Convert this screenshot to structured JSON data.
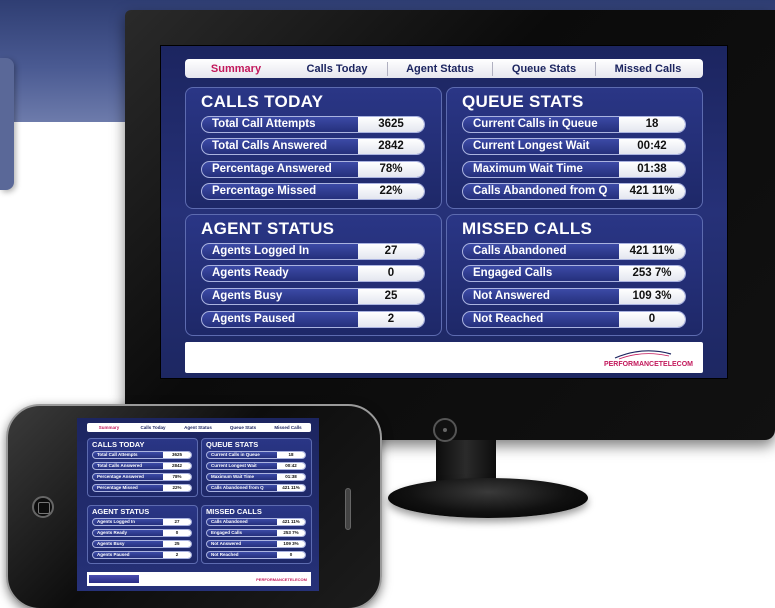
{
  "tabs": [
    "Summary",
    "Calls Today",
    "Agent Status",
    "Queue Stats",
    "Missed Calls"
  ],
  "active_tab": "Summary",
  "panels": {
    "calls_today": {
      "title": "CALLS TODAY",
      "rows": [
        {
          "label": "Total Call Attempts",
          "value": "3625"
        },
        {
          "label": "Total Calls Answered",
          "value": "2842"
        },
        {
          "label": "Percentage Answered",
          "value": "78%"
        },
        {
          "label": "Percentage Missed",
          "value": "22%"
        }
      ]
    },
    "queue_stats": {
      "title": "QUEUE STATS",
      "rows": [
        {
          "label": "Current Calls in Queue",
          "value": "18"
        },
        {
          "label": "Current Longest Wait",
          "value": "00:42"
        },
        {
          "label": "Maximum Wait Time",
          "value": "01:38"
        },
        {
          "label": "Calls Abandoned from Q",
          "value": "421  11%"
        }
      ]
    },
    "agent_status": {
      "title": "AGENT STATUS",
      "rows": [
        {
          "label": "Agents Logged In",
          "value": "27"
        },
        {
          "label": "Agents Ready",
          "value": "0"
        },
        {
          "label": "Agents Busy",
          "value": "25"
        },
        {
          "label": "Agents Paused",
          "value": "2"
        }
      ]
    },
    "missed_calls": {
      "title": "MISSED CALLS",
      "rows": [
        {
          "label": "Calls Abandoned",
          "value": "421  11%"
        },
        {
          "label": "Engaged Calls",
          "value": "253  7%"
        },
        {
          "label": "Not Answered",
          "value": "109  3%"
        },
        {
          "label": "Not Reached",
          "value": "0"
        }
      ]
    }
  },
  "logo": {
    "text": "PERFORMANCETELECOM"
  },
  "colors": {
    "background_band": "#3e4d86",
    "screen": "#1e2868",
    "panel_border": "#5d6bb0",
    "accent_active_tab": "#c2185b"
  }
}
